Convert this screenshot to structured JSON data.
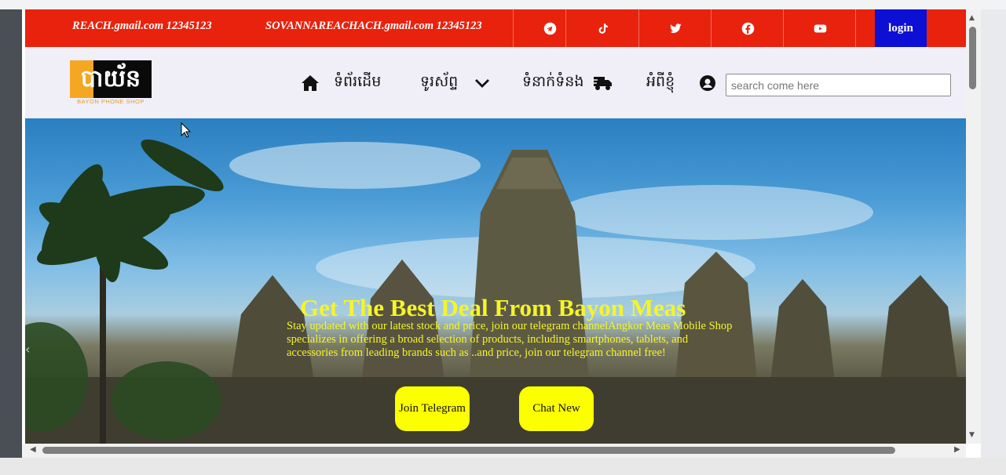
{
  "topbar": {
    "email1": "REACH.gmail.com 12345123",
    "email2": "SOVANNAREACHACH.gmail.com 12345123",
    "social": [
      "telegram-icon",
      "tiktok-icon",
      "twitter-icon",
      "facebook-icon",
      "youtube-icon"
    ],
    "login_label": "login",
    "color": "#e8220d",
    "login_color": "#0d0fd4"
  },
  "logo": {
    "text": " បាយ័ន",
    "subtitle": "BAYON PHONE SHOP"
  },
  "nav": {
    "home": "ទំព័រដើម",
    "phones": "ទូរស័ព្ទ",
    "contact": "ទំនាក់ទំនង",
    "about": "អំពីខ្ញុំ"
  },
  "search": {
    "placeholder": "search come here"
  },
  "hero": {
    "title": "Get The Best Deal From Bayon Meas",
    "description": "Stay updated with our latest stock and price, join our telegram channelAngkor Meas Mobile Shop specializes in offering a broad selection of products, including smartphones, tablets, and accessories from leading brands such as ..and price, join our telegram channel free!",
    "btn_telegram": "Join Telegram",
    "btn_chat": "Chat New",
    "text_color": "#f5f528",
    "button_color": "#fbff00"
  }
}
